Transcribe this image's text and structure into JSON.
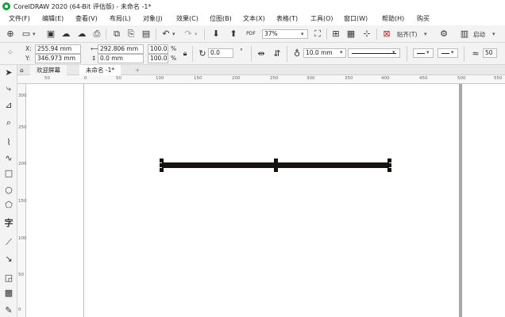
{
  "title_bar": {
    "title": "CorelDRAW 2020 (64-Bit 评估版) - 未命名 -1*"
  },
  "menu": {
    "items": [
      "文件(F)",
      "编辑(E)",
      "查看(V)",
      "布局(L)",
      "对象(J)",
      "效果(C)",
      "位图(B)",
      "文本(X)",
      "表格(T)",
      "工具(O)",
      "窗口(W)",
      "帮助(H)",
      "购买"
    ]
  },
  "toolbar": {
    "zoom_value": "37%",
    "snap_label": "贴齐(T)",
    "launch_label": "启动",
    "icons": [
      "new-icon",
      "open-icon",
      "save-icon",
      "cloud-download-icon",
      "cloud-upload-icon",
      "print-icon",
      "undo-icon",
      "redo-icon",
      "import-icon",
      "export-icon",
      "pdf-icon",
      "full-screen-icon",
      "rulers-icon",
      "grid-icon",
      "guidelines-icon",
      "snap-icon",
      "options-icon"
    ]
  },
  "properties": {
    "x_label": "X:",
    "y_label": "Y:",
    "x_value": "255.94 mm",
    "y_value": "346.973 mm",
    "width_value": "292.806 mm",
    "height_value": "0.0 mm",
    "scale_x": "100.0",
    "scale_y": "100.0",
    "percent": "%",
    "rotation_value": "0.0",
    "degree_symbol": "°",
    "outline_width": "10.0 mm",
    "arrow_width": "50"
  },
  "tabs": {
    "welcome": "欢迎屏幕",
    "document": "未命名 -1*",
    "add": "+"
  },
  "ruler": {
    "h_labels": [
      "50",
      "0",
      "50",
      "100",
      "150",
      "200",
      "250",
      "300",
      "350",
      "400",
      "450",
      "500",
      "550"
    ],
    "v_labels": [
      "300",
      "250",
      "200",
      "150",
      "100",
      "50",
      "0"
    ]
  },
  "toolbox": {
    "tools": [
      "pick-tool-icon",
      "shape-tool-icon",
      "crop-tool-icon",
      "zoom-tool-icon",
      "freehand-tool-icon",
      "artistic-media-icon",
      "rectangle-tool-icon",
      "ellipse-tool-icon",
      "polygon-tool-icon",
      "text-tool-icon",
      "parallel-dimension-icon",
      "connector-tool-icon",
      "drop-shadow-icon",
      "transparency-icon",
      "eyedropper-icon"
    ],
    "text_tool_glyph": "字"
  },
  "colors": {
    "line": "#1a1410",
    "logo": "#1f9e3b"
  }
}
